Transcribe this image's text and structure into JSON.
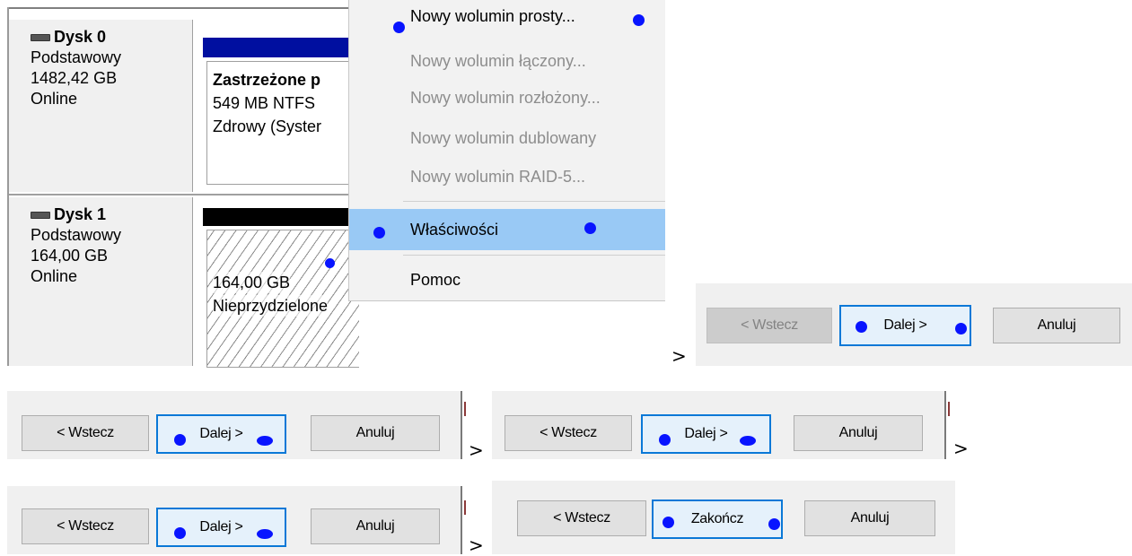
{
  "disks": [
    {
      "name": "Dysk 0",
      "type": "Podstawowy",
      "size": "1482,42 GB",
      "status": "Online",
      "volume": {
        "title": "Zastrzeżone p",
        "size_fs": "549 MB NTFS",
        "health": "Zdrowy (Syster"
      }
    },
    {
      "name": "Dysk 1",
      "type": "Podstawowy",
      "size": "164,00 GB",
      "status": "Online",
      "volume": {
        "size": "164,00 GB",
        "state": "Nieprzydzielone"
      }
    }
  ],
  "context_menu": {
    "items": [
      {
        "label": "Nowy wolumin prosty...",
        "enabled": true
      },
      {
        "label": "Nowy wolumin łączony...",
        "enabled": false
      },
      {
        "label": "Nowy wolumin rozłożony...",
        "enabled": false
      },
      {
        "label": "Nowy wolumin dublowany",
        "enabled": false
      },
      {
        "label": "Nowy wolumin RAID-5...",
        "enabled": false
      },
      {
        "label": "Właściwości",
        "enabled": true,
        "highlighted": true
      },
      {
        "label": "Pomoc",
        "enabled": true
      }
    ]
  },
  "arrow": ">",
  "wizard_steps": [
    {
      "back": "< Wstecz",
      "next": "Dalej >",
      "cancel": "Anuluj",
      "back_enabled": false
    },
    {
      "back": "< Wstecz",
      "next": "Dalej >",
      "cancel": "Anuluj",
      "back_enabled": true
    },
    {
      "back": "< Wstecz",
      "next": "Dalej >",
      "cancel": "Anuluj",
      "back_enabled": true
    },
    {
      "back": "< Wstecz",
      "next": "Dalej >",
      "cancel": "Anuluj",
      "back_enabled": true
    },
    {
      "back": "< Wstecz",
      "next": "Zakończ",
      "cancel": "Anuluj",
      "back_enabled": true
    }
  ],
  "colors": {
    "marker": "#0814ff",
    "highlight": "#99c9f5",
    "default_button_border": "#0a78d7"
  }
}
